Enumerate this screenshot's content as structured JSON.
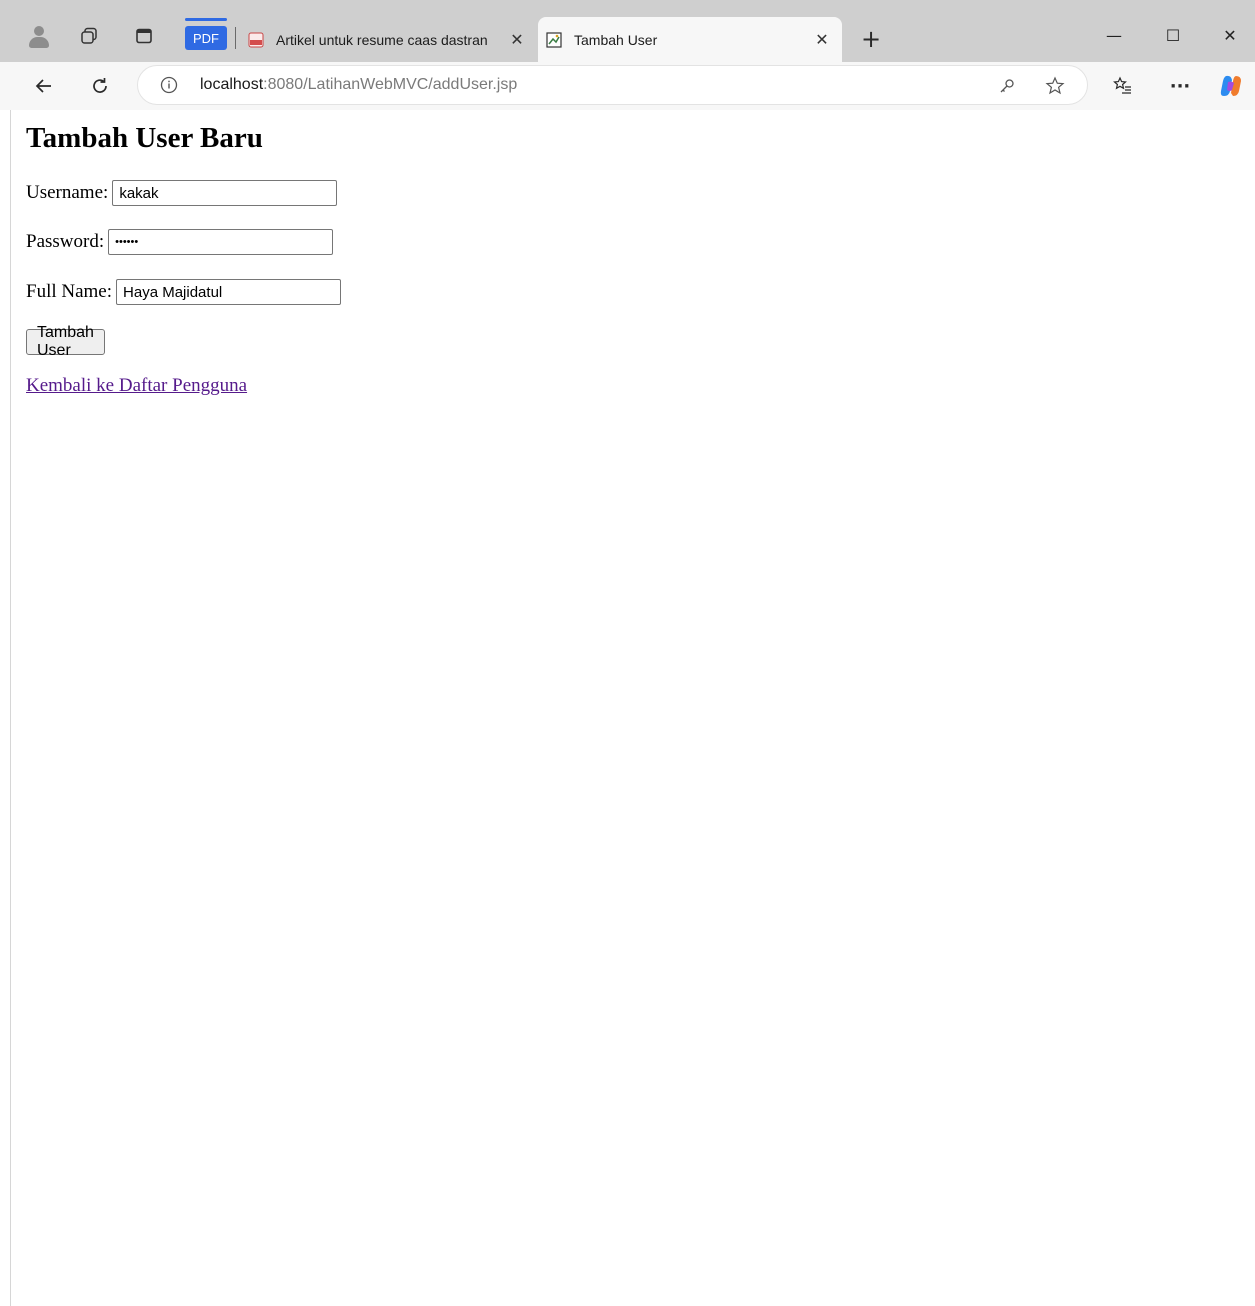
{
  "browser": {
    "pdf_group_label": "PDF",
    "tabs": [
      {
        "title": "Artikel untuk resume caas dastran",
        "close": "✕",
        "active": false
      },
      {
        "title": "Tambah User",
        "close": "✕",
        "active": true
      }
    ],
    "new_tab": "+",
    "window_controls": {
      "minimize": "—",
      "maximize": "☐",
      "close": "✕"
    },
    "address": {
      "host": "localhost",
      "rest": ":8080/LatihanWebMVC/addUser.jsp"
    },
    "more_menu": "···"
  },
  "page": {
    "title": "Tambah User Baru",
    "username": {
      "label": "Username:",
      "value": "kakak"
    },
    "password": {
      "label": "Password:",
      "value": "••••••"
    },
    "fullname": {
      "label": "Full Name:",
      "value": "Haya Majidatul"
    },
    "submit_label": "Tambah User",
    "back_link": "Kembali ke Daftar Pengguna"
  },
  "colors": {
    "chrome_bg": "#cfcfcf",
    "toolbar_bg": "#f7f7f7",
    "pdf_accent": "#2f6ae3",
    "visited_link": "#551a8b"
  },
  "icons": [
    "profile-icon",
    "workspaces-icon",
    "tab-actions-icon",
    "pdf-file-icon",
    "page-image-icon",
    "back-icon",
    "refresh-icon",
    "info-icon",
    "password-key-icon",
    "favorite-star-icon",
    "favorites-list-icon",
    "more-icon",
    "copilot-icon"
  ]
}
